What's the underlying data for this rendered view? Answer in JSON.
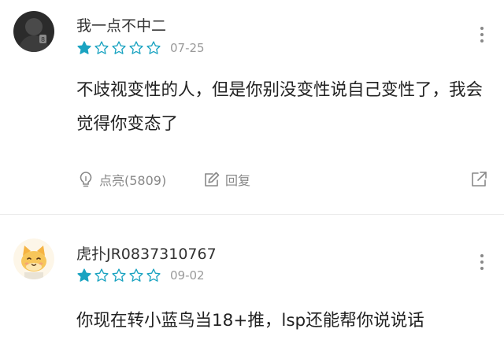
{
  "colors": {
    "star_filled": "#1aa3c1",
    "star_empty": "#1aa3c1",
    "meta_gray": "#9a9a9a",
    "action_gray": "#888888",
    "text": "#222222"
  },
  "comments": [
    {
      "username": "我一点不中二",
      "rating": 1,
      "rating_max": 5,
      "date": "07-25",
      "text": "不歧视变性的人，但是你别没变性说自己变性了，我会觉得你变态了",
      "avatar_icon": "dark-photo-avatar",
      "actions": {
        "like_label": "点亮(5809)",
        "reply_label": "回复",
        "share_icon": "share-icon"
      }
    },
    {
      "username": "虎扑JR0837310767",
      "rating": 1,
      "rating_max": 5,
      "date": "09-02",
      "text": "你现在转小蓝鸟当18+推，lsp还能帮你说说话",
      "avatar_icon": "cartoon-cat-avatar"
    }
  ]
}
